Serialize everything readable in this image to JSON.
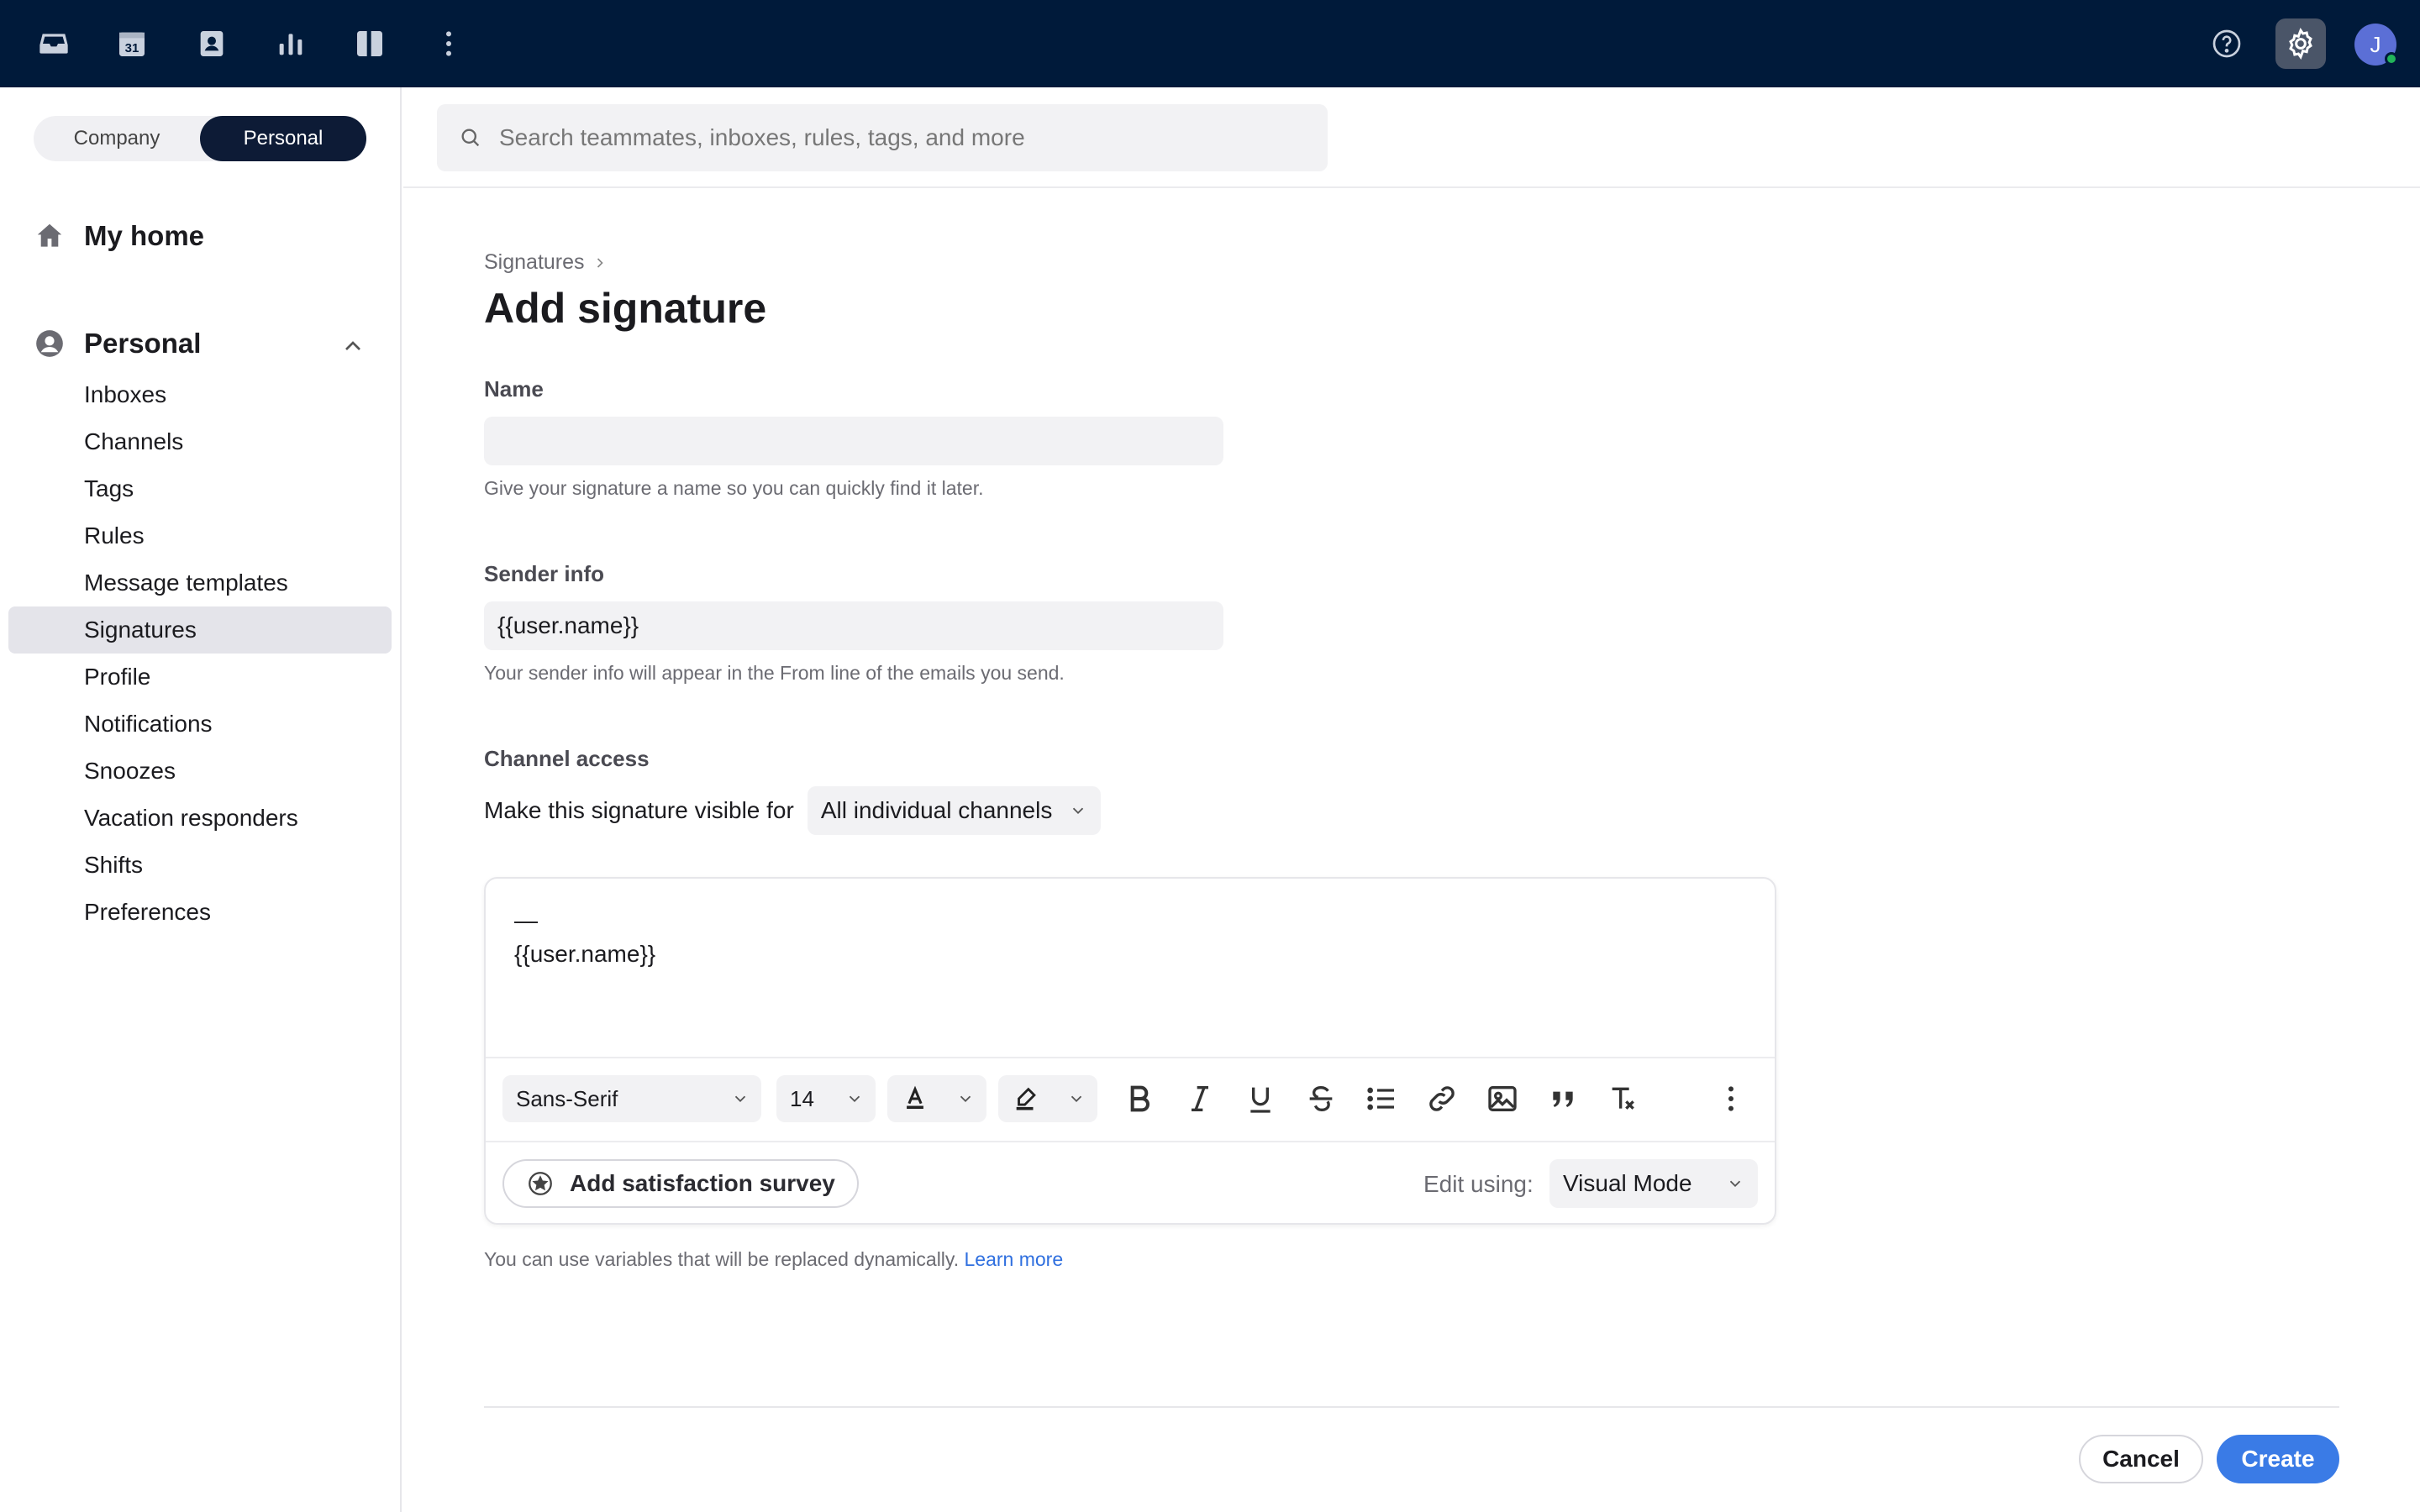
{
  "topbar": {
    "icons": [
      "inbox-icon",
      "calendar-icon",
      "contacts-icon",
      "analytics-icon",
      "split-view-icon",
      "more-icon"
    ],
    "calendar_day": "31",
    "right_icons": [
      "help-icon",
      "settings-icon"
    ],
    "avatar_initial": "J",
    "colors": {
      "bar": "#001a3a",
      "avatar": "#5b6fd6",
      "status": "#22b45a"
    }
  },
  "sidebar": {
    "toggle": {
      "company": "Company",
      "personal": "Personal",
      "selected": "Personal"
    },
    "my_home": "My home",
    "personal_section": "Personal",
    "items": [
      {
        "label": "Inboxes"
      },
      {
        "label": "Channels"
      },
      {
        "label": "Tags"
      },
      {
        "label": "Rules"
      },
      {
        "label": "Message templates"
      },
      {
        "label": "Signatures",
        "active": true
      },
      {
        "label": "Profile"
      },
      {
        "label": "Notifications"
      },
      {
        "label": "Snoozes"
      },
      {
        "label": "Vacation responders"
      },
      {
        "label": "Shifts"
      },
      {
        "label": "Preferences"
      }
    ]
  },
  "search": {
    "placeholder": "Search teammates, inboxes, rules, tags, and more",
    "value": ""
  },
  "form": {
    "breadcrumb": "Signatures",
    "title": "Add signature",
    "name_label": "Name",
    "name_value": "",
    "name_help": "Give your signature a name so you can quickly find it later.",
    "sender_label": "Sender info",
    "sender_value": "{{user.name}}",
    "sender_help": "Your sender info will appear in the From line of the emails you send.",
    "channel_label": "Channel access",
    "visible_for_text": "Make this signature visible for",
    "visible_for_value": "All individual channels"
  },
  "editor": {
    "line1": "—",
    "line2": "{{user.name}}",
    "font": "Sans-Serif",
    "size": "14",
    "format_tools": [
      "bold-icon",
      "italic-icon",
      "underline-icon",
      "strikethrough-icon",
      "list-icon",
      "link-icon",
      "image-icon",
      "quote-icon",
      "clear-format-icon",
      "more-icon"
    ],
    "survey_label": "Add satisfaction survey",
    "edit_using_label": "Edit using:",
    "mode_value": "Visual Mode"
  },
  "note": {
    "text": "You can use variables that will be replaced dynamically.",
    "link": "Learn more"
  },
  "actions": {
    "cancel": "Cancel",
    "create": "Create",
    "primary_color": "#3a7be6"
  }
}
